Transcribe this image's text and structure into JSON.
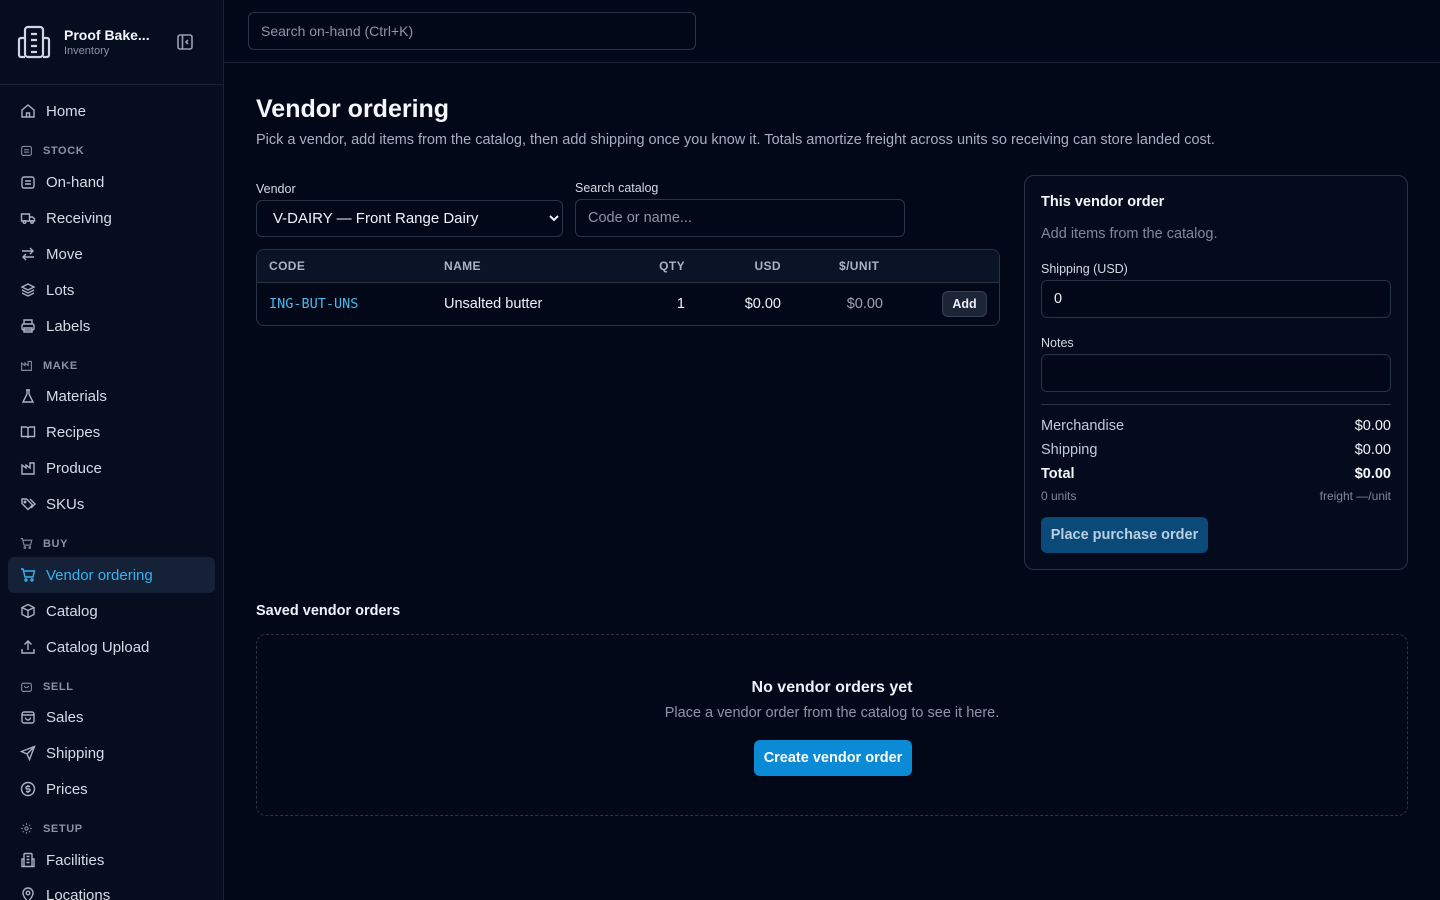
{
  "brand": {
    "name": "Proof Bake...",
    "subtitle": "Inventory"
  },
  "sidebar": {
    "home": "Home",
    "sections": {
      "stock": "STOCK",
      "make": "MAKE",
      "buy": "BUY",
      "sell": "SELL",
      "setup": "SETUP"
    },
    "items": {
      "on_hand": "On-hand",
      "receiving": "Receiving",
      "move": "Move",
      "lots": "Lots",
      "labels": "Labels",
      "materials": "Materials",
      "recipes": "Recipes",
      "produce": "Produce",
      "skus": "SKUs",
      "vendor_ordering": "Vendor ordering",
      "catalog": "Catalog",
      "catalog_upload": "Catalog Upload",
      "sales": "Sales",
      "shipping": "Shipping",
      "prices": "Prices",
      "facilities": "Facilities",
      "locations": "Locations"
    },
    "active": "vendor_ordering"
  },
  "topbar": {
    "search_placeholder": "Search on-hand (Ctrl+K)"
  },
  "page": {
    "title": "Vendor ordering",
    "description": "Pick a vendor, add items from the catalog, then add shipping once you know it. Totals amortize freight across units so receiving can store landed cost."
  },
  "vendor": {
    "label": "Vendor",
    "selected": "V-DAIRY — Front Range Dairy"
  },
  "catalog_search": {
    "label": "Search catalog",
    "placeholder": "Code or name..."
  },
  "catalog_table": {
    "columns": {
      "code": "CODE",
      "name": "NAME",
      "qty": "QTY",
      "usd": "USD",
      "unit": "$/UNIT"
    },
    "rows": [
      {
        "code": "ING-BUT-UNS",
        "name": "Unsalted butter",
        "qty": "1",
        "usd": "$0.00",
        "unit": "$0.00",
        "action": "Add"
      }
    ]
  },
  "order_card": {
    "title": "This vendor order",
    "empty_text": "Add items from the catalog.",
    "shipping_label": "Shipping (USD)",
    "shipping_value": "0",
    "notes_label": "Notes",
    "notes_value": "",
    "merchandise_label": "Merchandise",
    "merchandise_value": "$0.00",
    "shipping_sum_label": "Shipping",
    "shipping_sum_value": "$0.00",
    "total_label": "Total",
    "total_value": "$0.00",
    "units_text": "0 units",
    "freight_text": "freight —/unit",
    "place_button": "Place purchase order"
  },
  "saved_orders": {
    "title": "Saved vendor orders",
    "empty_title": "No vendor orders yet",
    "empty_sub": "Place a vendor order from the catalog to see it here.",
    "create_button": "Create vendor order"
  },
  "colors": {
    "background": "#020817",
    "sidebar": "#050d1f",
    "accent": "#38b2f0",
    "primary_button": "#0b8ad6",
    "disabled_button": "#0b4a78",
    "border": "#2a3447"
  }
}
